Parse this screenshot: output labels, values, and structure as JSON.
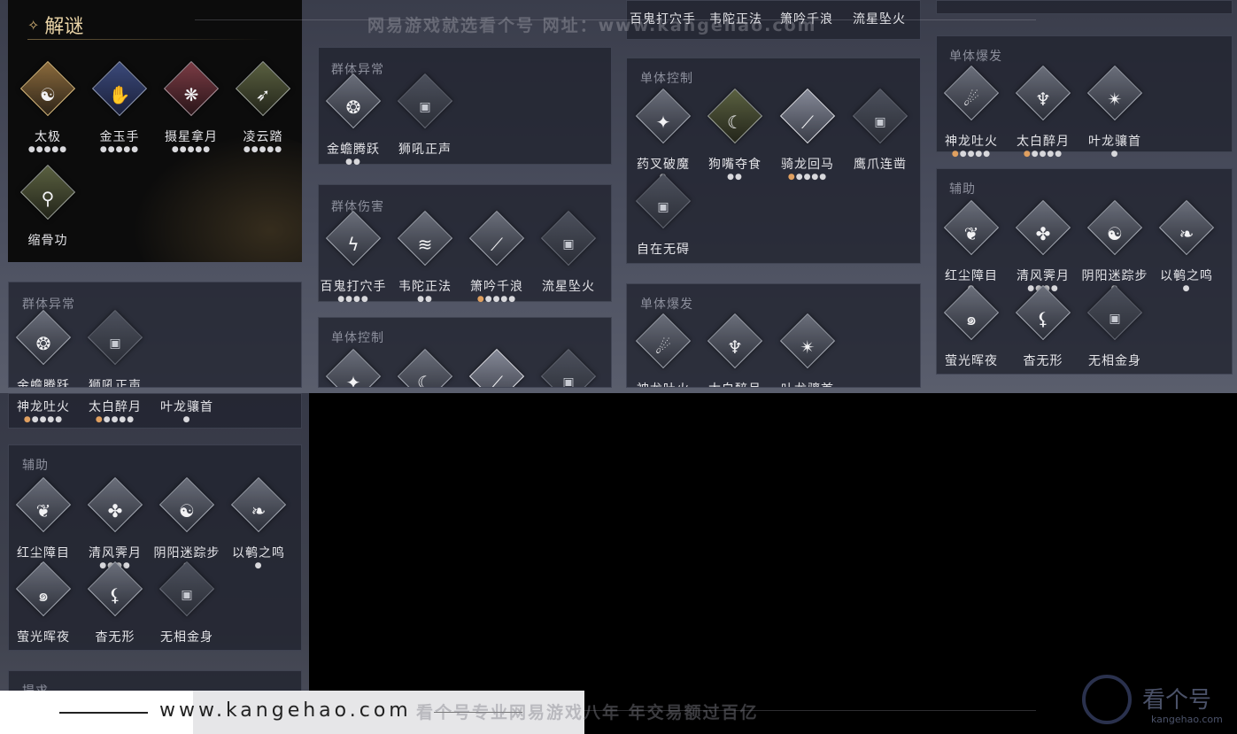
{
  "puzzle_panel": {
    "title": "解谜",
    "title_icon": "✧",
    "skills": [
      {
        "label": "太极",
        "dots": "●●●●●",
        "glyph": "☯",
        "style": "gold"
      },
      {
        "label": "金玉手",
        "dots": "●●●●●",
        "glyph": "✋",
        "style": "navy"
      },
      {
        "label": "摄星拿月",
        "dots": "●●●●●",
        "glyph": "❋",
        "style": "wine"
      },
      {
        "label": "凌云踏",
        "dots": "●●●●●",
        "glyph": "➶",
        "style": "olive"
      },
      {
        "label": "缩骨功",
        "dots": "",
        "glyph": "⚲",
        "style": "olive"
      }
    ]
  },
  "col2": {
    "group_abnormal": {
      "title": "群体异常",
      "skills": [
        {
          "label": "金蟾腾跃",
          "dots": "●●"
        },
        {
          "label": "狮吼正声",
          "dots": ""
        }
      ]
    },
    "group_damage": {
      "title": "群体伤害",
      "skills": [
        {
          "label": "百鬼打穴手",
          "dots": "●●●●"
        },
        {
          "label": "韦陀正法",
          "dots": "●●"
        },
        {
          "label": "箫吟千浪",
          "dots": "●●●●●"
        },
        {
          "label": "流星坠火",
          "dots": ""
        }
      ]
    },
    "single_control_partial": {
      "title": "单体控制"
    }
  },
  "col3": {
    "top_strip": [
      "百鬼打穴手",
      "韦陀正法",
      "箫吟千浪",
      "流星坠火"
    ],
    "single_control": {
      "title": "单体控制",
      "skills": [
        {
          "label": "药叉破魔",
          "dots": "●"
        },
        {
          "label": "狗嘴夺食",
          "dots": "●●"
        },
        {
          "label": "骑龙回马",
          "dots": "●●●●●"
        },
        {
          "label": "鹰爪连凿",
          "dots": ""
        },
        {
          "label": "自在无碍",
          "dots": ""
        }
      ]
    },
    "single_burst": {
      "title": "单体爆发",
      "skills": [
        {
          "label": "神龙吐火",
          "dots": ""
        },
        {
          "label": "太白醉月",
          "dots": ""
        },
        {
          "label": "叶龙骧首",
          "dots": ""
        }
      ]
    }
  },
  "col4": {
    "single_burst": {
      "title": "单体爆发",
      "skills": [
        {
          "label": "神龙吐火",
          "dots": "●●●●●"
        },
        {
          "label": "太白醉月",
          "dots": "●●●●●"
        },
        {
          "label": "叶龙骧首",
          "dots": "●"
        }
      ]
    },
    "support": {
      "title": "辅助",
      "skills": [
        {
          "label": "红尘障目",
          "dots": "●"
        },
        {
          "label": "清风霁月",
          "dots": "●●●●"
        },
        {
          "label": "阴阳迷踪步",
          "dots": "●"
        },
        {
          "label": "以鹌之鸣",
          "dots": "●"
        },
        {
          "label": "萤光晖夜",
          "dots": ""
        },
        {
          "label": "杳无形",
          "dots": ""
        },
        {
          "label": "无相金身",
          "dots": ""
        }
      ]
    }
  },
  "left_lower": {
    "group_abnormal": {
      "title": "群体异常",
      "skills": [
        {
          "label": "金蟾腾跃",
          "dots": ""
        },
        {
          "label": "狮吼正声",
          "dots": ""
        }
      ]
    },
    "burst_strip": [
      {
        "label": "神龙吐火",
        "dots": "●●●●●"
      },
      {
        "label": "太白醉月",
        "dots": "●●●●●"
      },
      {
        "label": "叶龙骧首",
        "dots": "●"
      }
    ],
    "support": {
      "title": "辅助",
      "skills": [
        {
          "label": "红尘障目",
          "dots": "●"
        },
        {
          "label": "清风霁月",
          "dots": "●●●●"
        },
        {
          "label": "阴阳迷踪步",
          "dots": "●"
        },
        {
          "label": "以鹌之鸣",
          "dots": "●"
        },
        {
          "label": "萤光晖夜",
          "dots": ""
        },
        {
          "label": "杳无形",
          "dots": ""
        },
        {
          "label": "无相金身",
          "dots": ""
        }
      ]
    },
    "bottom_partial_title": "提求"
  },
  "watermarks": {
    "top": "网易游戏就选看个号  网址：www.kangehao.com",
    "bottom": "看个号专业网易游戏八年   年交易额过百亿"
  },
  "brand": {
    "url": "www.kangehao.com",
    "logo_text": "看个号",
    "logo_sub": "kangehao.com"
  }
}
